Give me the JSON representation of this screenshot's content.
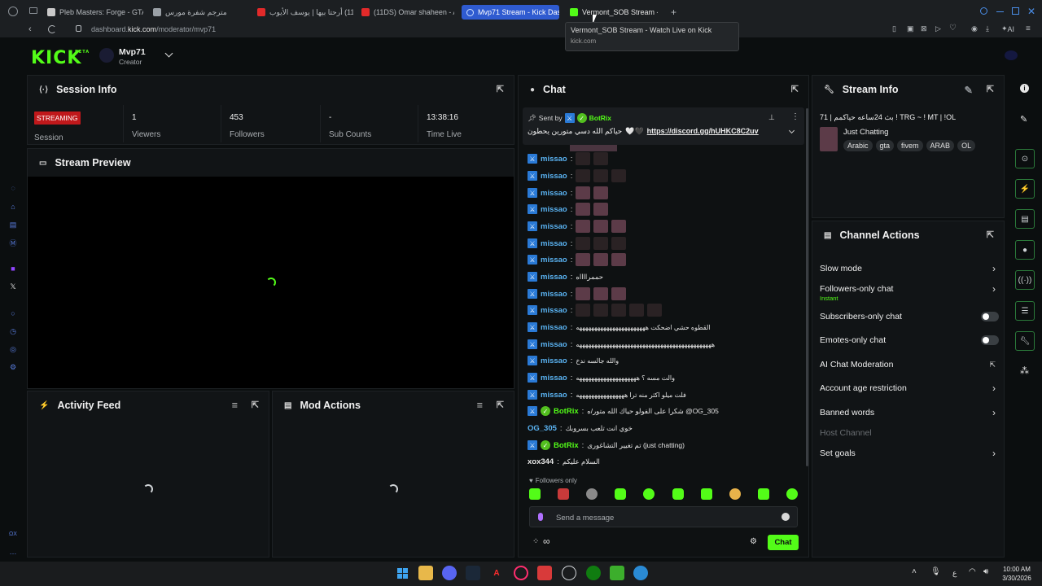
{
  "browser": {
    "tabs": [
      {
        "label": "Pleb Masters: Forge - GTA"
      },
      {
        "label": "مترجم شفرة مورس"
      },
      {
        "label": "أرحتا بيها | يوسف الأيوب (11DS)"
      },
      {
        "label": "(11DS) Omar shaheen - An"
      },
      {
        "label": "Mvp71 Stream - Kick Das"
      },
      {
        "label": "Vermont_SOB Stream -"
      }
    ],
    "url_prefix": "dashboard.",
    "url_domain": "kick.com",
    "url_path": "/moderator/mvp71",
    "tooltip_title": "Vermont_SOB Stream - Watch Live on Kick",
    "tooltip_url": "kick.com",
    "ai_label": "AI"
  },
  "header": {
    "logo": "KICK",
    "logo_badge": "BETA",
    "channel_name": "Mvp71",
    "channel_role": "Creator"
  },
  "session": {
    "title": "Session Info",
    "status_badge": "STREAMING",
    "status_label": "Session",
    "metrics": [
      {
        "value": "1",
        "label": "Viewers"
      },
      {
        "value": "453",
        "label": "Followers"
      },
      {
        "value": "-",
        "label": "Sub Counts"
      },
      {
        "value": "13:38:16",
        "label": "Time Live"
      }
    ]
  },
  "preview": {
    "title": "Stream Preview"
  },
  "activity": {
    "title": "Activity Feed"
  },
  "modactions": {
    "title": "Mod Actions"
  },
  "chat": {
    "title": "Chat",
    "pinned_sent_by": "Sent by",
    "pinned_user": "BotRix",
    "pinned_text": "حياكم الله دسي متورين يحطون",
    "pinned_link": "https://discord.gg/hUHKC8C2uv",
    "messages": [
      {
        "user": "missao",
        "text": ""
      },
      {
        "user": "missao",
        "text": ""
      },
      {
        "user": "missao",
        "text": ""
      },
      {
        "user": "missao",
        "text": ""
      },
      {
        "user": "missao",
        "text": ""
      },
      {
        "user": "missao",
        "text": ""
      },
      {
        "user": "missao",
        "text": ""
      },
      {
        "user": "missao",
        "text": "حممرااااه"
      },
      {
        "user": "missao",
        "text": ""
      },
      {
        "user": "missao",
        "text": ""
      },
      {
        "user": "missao",
        "text": "القطوه حشي اضحكت هههههههههههههههههههههههه"
      },
      {
        "user": "missao",
        "text": "هههههههههههههههههههههههههههههههههههههههههههههه"
      },
      {
        "user": "missao",
        "text": "والله جالسه ندخ"
      },
      {
        "user": "missao",
        "text": "والت مسه ؟ ههههههههههههههههههههه"
      },
      {
        "user": "missao",
        "text": "فلت ميلو اكثر منه ترا ههههههههههههههههه"
      },
      {
        "user": "BotRix",
        "text": "شكرا على الفولو حياك الله متور/ه @OG_305"
      },
      {
        "user": "OG_305",
        "text": "خوي انت تلعب بسروبك"
      },
      {
        "user": "BotRix",
        "text": "تم تغيير التشاغورى (just chatting)"
      },
      {
        "user": "xox344",
        "text": "السلام عليكم"
      }
    ],
    "followers_only": "Followers only",
    "input_placeholder": "Send a message",
    "send_label": "Chat"
  },
  "stream_info": {
    "title": "Stream Info",
    "stream_title": "بث 24ساعه حياكمم | 71 ! TRG ~ ! MT | !OL",
    "category": "Just Chatting",
    "tags": [
      "Arabic",
      "gta",
      "fivem",
      "ARAB",
      "OL"
    ]
  },
  "channel_actions": {
    "title": "Channel Actions",
    "slow_mode": "Slow mode",
    "followers_only_chat": "Followers-only chat",
    "followers_only_sub": "Instant",
    "subscribers_only_chat": "Subscribers-only chat",
    "emotes_only_chat": "Emotes-only chat",
    "ai_moderation": "AI Chat Moderation",
    "account_age": "Account age restriction",
    "banned_words": "Banned words",
    "host_channel": "Host Channel",
    "set_goals": "Set goals"
  },
  "taskbar": {
    "lang": "ع",
    "time": "10:00 AM",
    "date": "3/30/2026"
  },
  "colors": {
    "accent": "#53fc18",
    "streaming": "#c0181b",
    "username": "#5ab3f2"
  }
}
